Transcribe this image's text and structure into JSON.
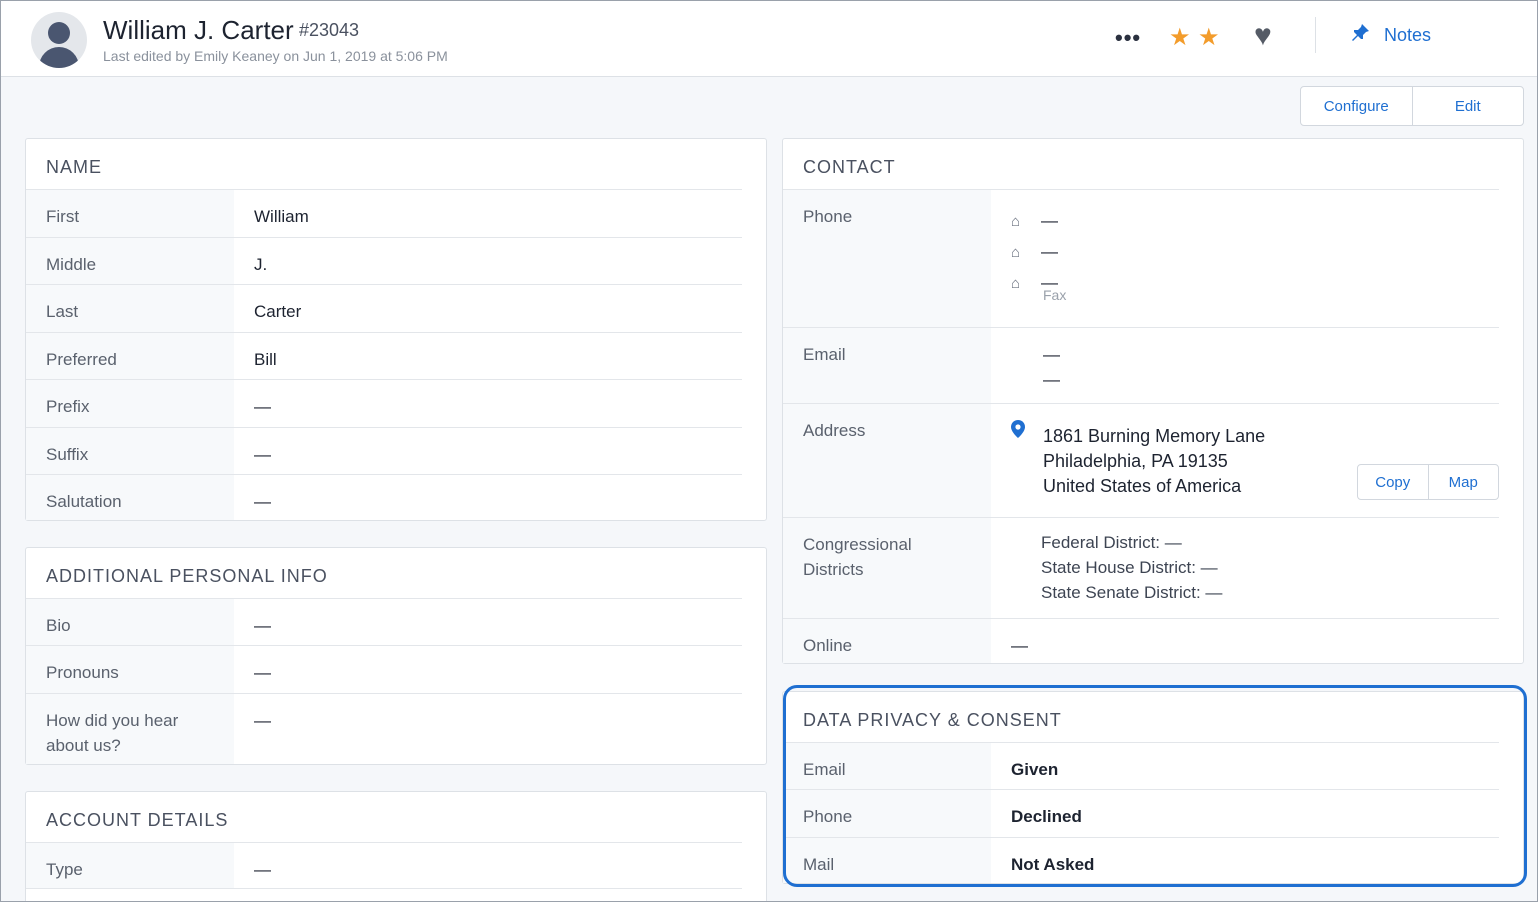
{
  "header": {
    "name": "William J. Carter",
    "id": "#23043",
    "subtitle": "Last edited by Emily Keaney on Jun 1, 2019 at 5:06 PM",
    "more_label": "•••",
    "notes_label": "Notes",
    "star_count": 2,
    "icons": {
      "more": "ellipsis-icon",
      "star": "star-icon",
      "heart": "heart-icon",
      "pin": "pin-icon"
    },
    "colors": {
      "star": "#f39c2b",
      "link": "#1f6fd1"
    }
  },
  "toolbar": {
    "configure_label": "Configure",
    "edit_label": "Edit"
  },
  "name_panel": {
    "title": "NAME",
    "rows": [
      {
        "label": "First",
        "value": "William"
      },
      {
        "label": "Middle",
        "value": "J."
      },
      {
        "label": "Last",
        "value": "Carter"
      },
      {
        "label": "Preferred",
        "value": "Bill"
      },
      {
        "label": "Prefix",
        "value": "—"
      },
      {
        "label": "Suffix",
        "value": "—"
      },
      {
        "label": "Salutation",
        "value": "—"
      }
    ]
  },
  "additional_panel": {
    "title": "ADDITIONAL PERSONAL INFO",
    "rows": [
      {
        "label": "Bio",
        "value": "—"
      },
      {
        "label": "Pronouns",
        "value": "—"
      },
      {
        "label_line1": "How did you hear",
        "label_line2": "about us?",
        "value": "—"
      }
    ]
  },
  "account_panel": {
    "title": "ACCOUNT DETAILS",
    "rows": [
      {
        "label": "Type",
        "value": "—"
      }
    ]
  },
  "contact_panel": {
    "title": "CONTACT",
    "phone": {
      "label": "Phone",
      "values": [
        "—",
        "—",
        "—"
      ],
      "fax_label": "Fax"
    },
    "email": {
      "label": "Email",
      "values": [
        "—",
        "—"
      ]
    },
    "address": {
      "label": "Address",
      "line1": "1861 Burning Memory Lane",
      "line2": "Philadelphia, PA 19135",
      "line3": "United States of America",
      "copy_label": "Copy",
      "map_label": "Map"
    },
    "districts": {
      "label_line1": "Congressional",
      "label_line2": "Districts",
      "federal": "Federal District: —",
      "house": "State House District: —",
      "senate": "State Senate District: —"
    },
    "online": {
      "label": "Online",
      "value": "—"
    }
  },
  "privacy_panel": {
    "title": "DATA PRIVACY & CONSENT",
    "rows": [
      {
        "label": "Email",
        "value": "Given"
      },
      {
        "label": "Phone",
        "value": "Declined"
      },
      {
        "label": "Mail",
        "value": "Not Asked"
      }
    ],
    "colors": {
      "given": "#2b8a1e",
      "declined": "#d8263b",
      "highlight": "#1f6fd1"
    }
  }
}
